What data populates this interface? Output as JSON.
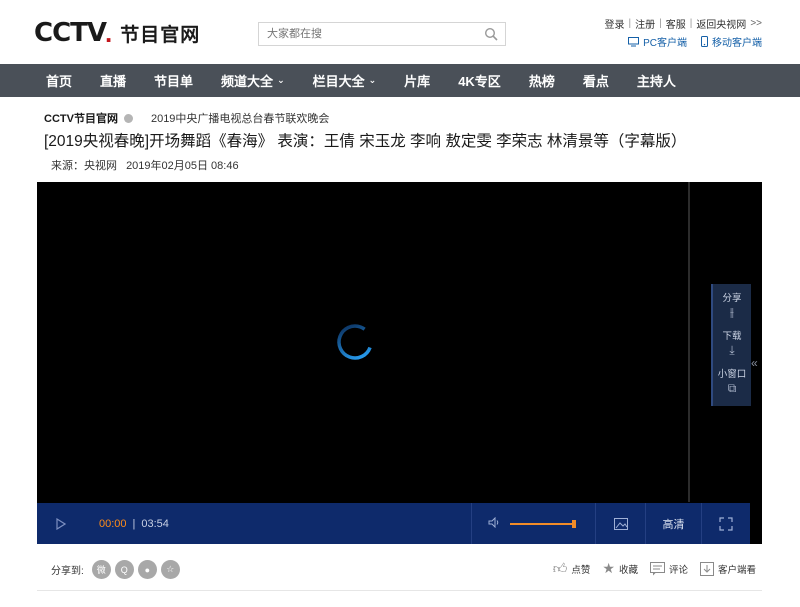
{
  "header": {
    "logo_mark": "CCTV",
    "logo_dot": ".",
    "logo_name": "节目官网",
    "search_placeholder": "大家都在搜",
    "top_links": [
      "登录",
      "注册",
      "客服",
      "返回央视网"
    ],
    "top_links_more": ">>",
    "pc_client": "PC客户端",
    "mobile_client": "移动客户端"
  },
  "nav": {
    "items": [
      {
        "label": "首页",
        "dropdown": false
      },
      {
        "label": "直播",
        "dropdown": false
      },
      {
        "label": "节目单",
        "dropdown": false
      },
      {
        "label": "频道大全",
        "dropdown": true
      },
      {
        "label": "栏目大全",
        "dropdown": true
      },
      {
        "label": "片库",
        "dropdown": false
      },
      {
        "label": "4K专区",
        "dropdown": false
      },
      {
        "label": "热榜",
        "dropdown": false
      },
      {
        "label": "看点",
        "dropdown": false
      },
      {
        "label": "主持人",
        "dropdown": false
      }
    ]
  },
  "breadcrumb": {
    "site": "CCTV节目官网",
    "column": "2019中央广播电视总台春节联欢晚会"
  },
  "video": {
    "title": "[2019央视春晚]开场舞蹈《春海》 表演：王倩 宋玉龙 李响 敖定雯 李荣志 林清景等（字幕版）",
    "source_label": "来源：央视网",
    "date": "2019年02月05日 08:46"
  },
  "player": {
    "current_time": "00:00",
    "separator": "|",
    "duration": "03:54",
    "quality": "高清",
    "volume_level": 1.0,
    "side_panel": {
      "share": "分享",
      "download": "下载",
      "mini_window": "小窗口"
    }
  },
  "share": {
    "label": "分享到:",
    "targets": [
      "weibo-icon",
      "qq-icon",
      "wechat-icon",
      "favorite-star-icon"
    ]
  },
  "actions": {
    "like": "点赞",
    "collect": "收藏",
    "comment": "评论",
    "client": "客户端看"
  },
  "colors": {
    "nav_bg": "#4a5058",
    "controls_bg": "#0e2a6b",
    "time_current": "#ff8c1a",
    "brand_red": "#c4161c",
    "link_blue": "#1560a8"
  }
}
